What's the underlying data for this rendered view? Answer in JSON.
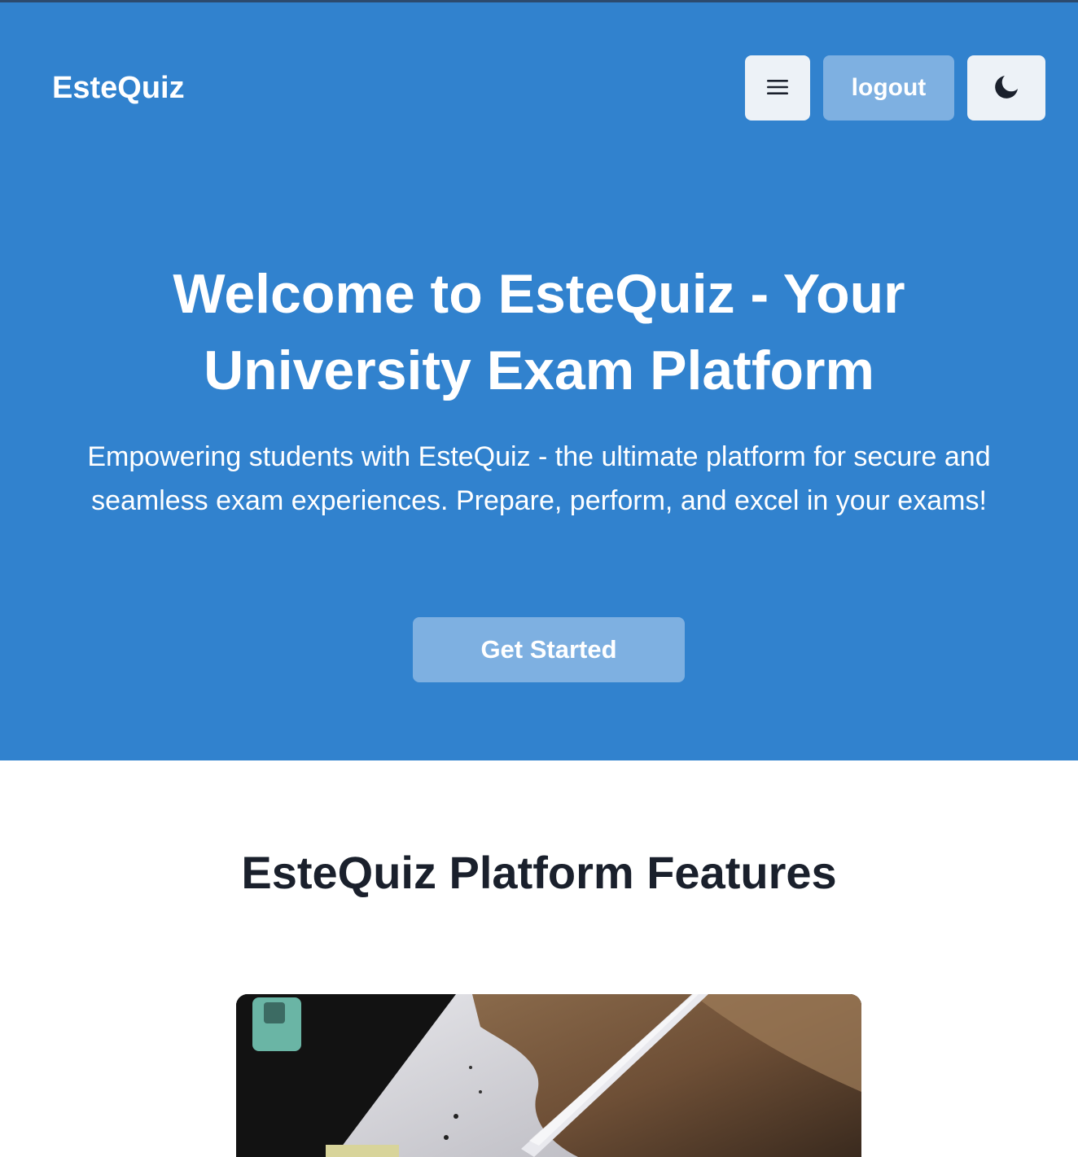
{
  "navbar": {
    "brand": "EsteQuiz",
    "menu_icon": "hamburger-icon",
    "logout_label": "logout",
    "theme_icon": "moon-icon"
  },
  "hero": {
    "title": "Welcome to EsteQuiz - Your University Exam Platform",
    "subtitle": "Empowering students with EsteQuiz - the ultimate platform for secure and seamless exam experiences. Prepare, perform, and excel in your exams!",
    "cta_label": "Get Started"
  },
  "features": {
    "title": "EsteQuiz Platform Features"
  },
  "colors": {
    "hero_bg": "#3182ce",
    "button_light": "#edf2f7",
    "button_accent": "#7eb0e1",
    "heading_dark": "#1a202c"
  }
}
